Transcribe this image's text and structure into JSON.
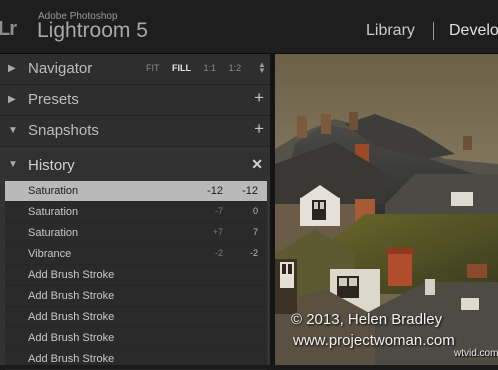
{
  "app": {
    "logo_glyph": "Lr",
    "vendor": "Adobe Photoshop",
    "product": "Lightroom 5"
  },
  "modules": {
    "library": "Library",
    "develop": "Develo"
  },
  "navigator": {
    "title": "Navigator",
    "options": [
      "FIT",
      "FILL",
      "1:1",
      "1:2"
    ],
    "selected": "FILL"
  },
  "presets": {
    "title": "Presets"
  },
  "snapshots": {
    "title": "Snapshots"
  },
  "history": {
    "title": "History",
    "items": [
      {
        "label": "Saturation",
        "v1": "-12",
        "v2": "-12",
        "active": true
      },
      {
        "label": "Saturation",
        "v1": "-7",
        "v2": "0"
      },
      {
        "label": "Saturation",
        "v1": "+7",
        "v2": "7"
      },
      {
        "label": "Vibrance",
        "v1": "-2",
        "v2": "-2"
      },
      {
        "label": "Add Brush Stroke",
        "v1": "",
        "v2": ""
      },
      {
        "label": "Add Brush Stroke",
        "v1": "",
        "v2": ""
      },
      {
        "label": "Add Brush Stroke",
        "v1": "",
        "v2": ""
      },
      {
        "label": "Add Brush Stroke",
        "v1": "",
        "v2": ""
      },
      {
        "label": "Add Brush Stroke",
        "v1": "",
        "v2": ""
      }
    ]
  },
  "photo": {
    "watermark_line1": "© 2013, Helen Bradley",
    "watermark_line2": "www.projectwoman.com",
    "site_stamp": "wtvid.com"
  },
  "colors": {
    "panel_bg": "#333333",
    "active_row": "#b9b9b9",
    "topbar_bg": "#1e1e1e"
  }
}
